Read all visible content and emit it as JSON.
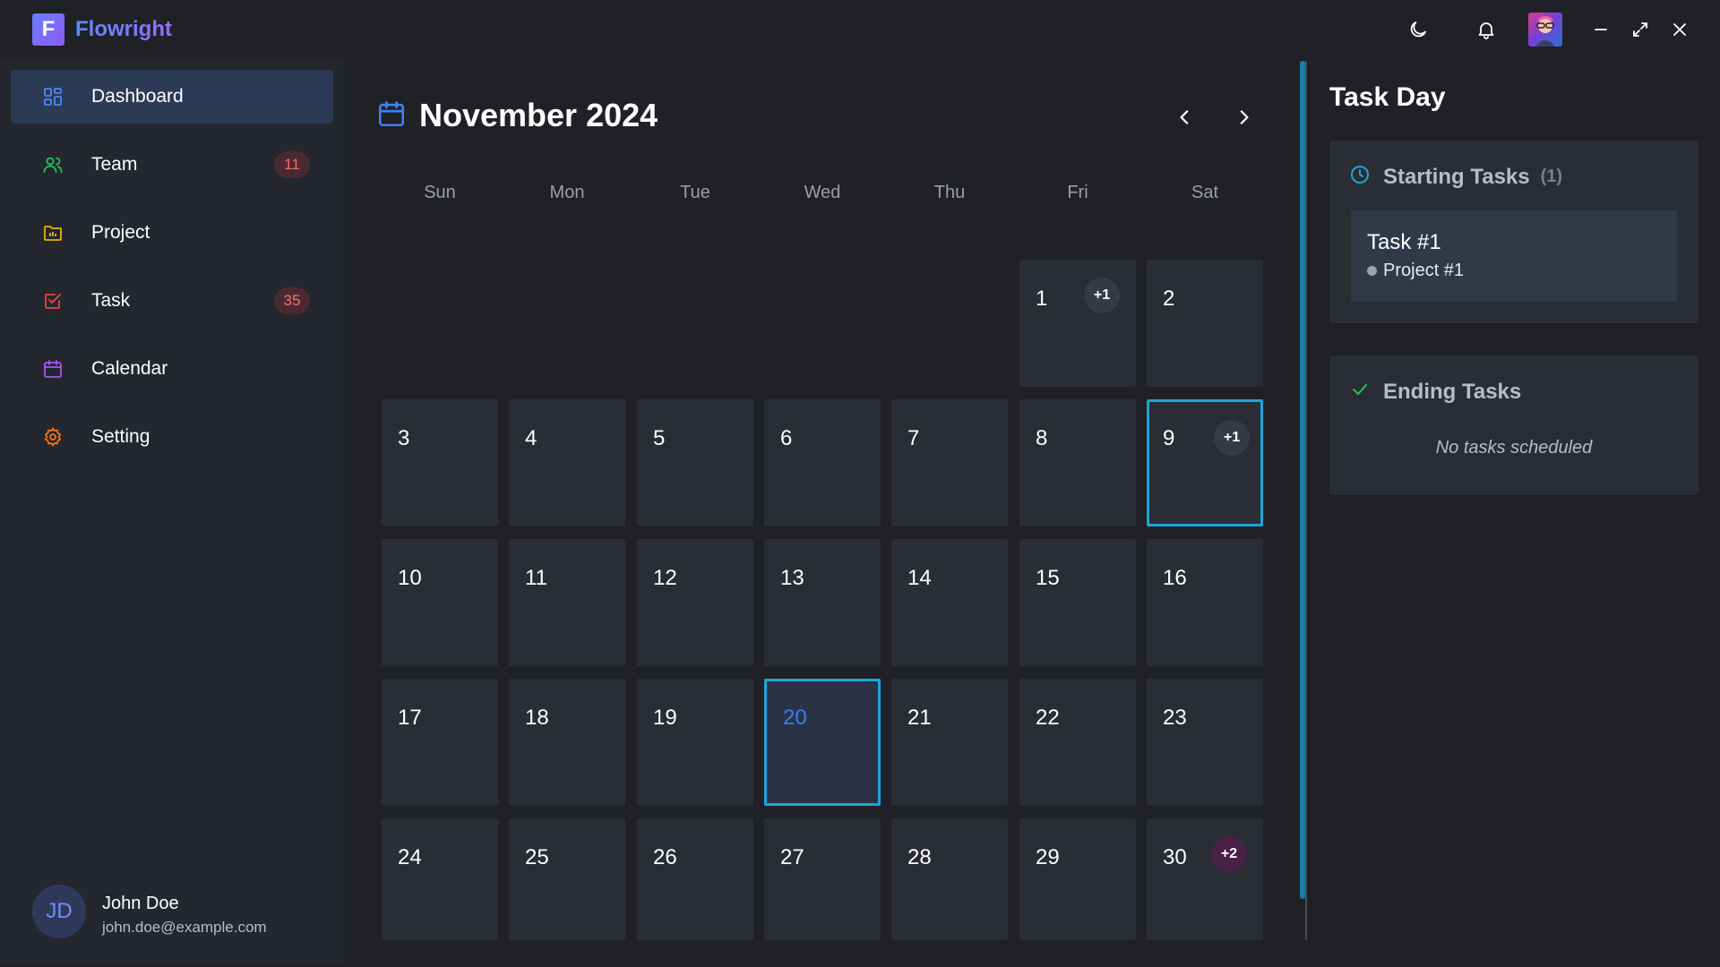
{
  "app": {
    "name": "Flowright",
    "logo_letter": "F"
  },
  "titlebar": {
    "icons": [
      "moon-icon",
      "bell-icon",
      "avatar",
      "minimize-icon",
      "maximize-icon",
      "close-icon"
    ]
  },
  "sidebar": {
    "items": [
      {
        "label": "Dashboard",
        "icon": "dashboard-icon",
        "active": true,
        "badge": ""
      },
      {
        "label": "Team",
        "icon": "team-icon",
        "active": false,
        "badge": "11"
      },
      {
        "label": "Project",
        "icon": "folder-icon",
        "active": false,
        "badge": ""
      },
      {
        "label": "Task",
        "icon": "task-icon",
        "active": false,
        "badge": "35"
      },
      {
        "label": "Calendar",
        "icon": "calendar-icon",
        "active": false,
        "badge": ""
      },
      {
        "label": "Setting",
        "icon": "gear-icon",
        "active": false,
        "badge": ""
      }
    ],
    "user": {
      "initials": "JD",
      "name": "John Doe",
      "email": "john.doe@example.com"
    }
  },
  "calendar": {
    "title": "November 2024",
    "weekdays": [
      "Sun",
      "Mon",
      "Tue",
      "Wed",
      "Thu",
      "Fri",
      "Sat"
    ],
    "first_weekday_index": 5,
    "days_in_month": 30,
    "today": 20,
    "selected": 9,
    "extra_badges": {
      "1": "+1",
      "9": "+1",
      "30": "+2"
    }
  },
  "task_day": {
    "title": "Task Day",
    "starting": {
      "label": "Starting Tasks",
      "count": "(1)",
      "tasks": [
        {
          "name": "Task #1",
          "project": "Project #1"
        }
      ]
    },
    "ending": {
      "label": "Ending Tasks",
      "empty_message": "No tasks scheduled"
    }
  },
  "colors": {
    "accent": "#1ea5d8",
    "today_text": "#3b7bf0",
    "badge_text": "#ff6b6b",
    "brand_gradient_start": "#5b8cff",
    "brand_gradient_end": "#9b6bff"
  }
}
